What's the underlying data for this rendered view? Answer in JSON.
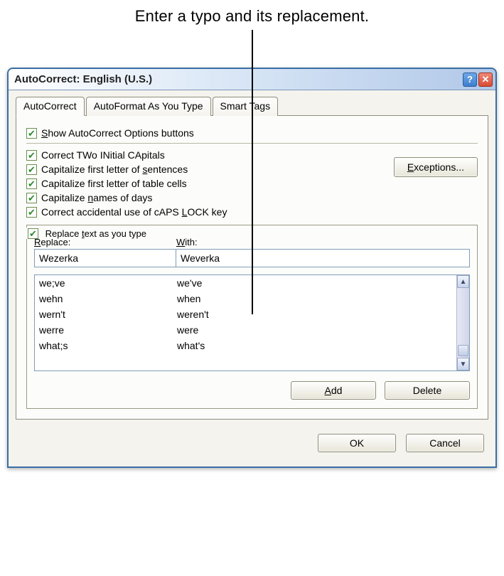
{
  "caption": "Enter a typo and its replacement.",
  "window": {
    "title": "AutoCorrect: English (U.S.)"
  },
  "tabs": [
    {
      "label": "AutoCorrect",
      "active": true
    },
    {
      "label": "AutoFormat As You Type",
      "active": false
    },
    {
      "label": "Smart Tags",
      "active": false
    }
  ],
  "checkboxes": {
    "show_buttons": "Show AutoCorrect Options buttons",
    "two_initial": "Correct TWo INitial CApitals",
    "first_sentence": "Capitalize first letter of sentences",
    "first_table": "Capitalize first letter of table cells",
    "names_days": "Capitalize names of days",
    "caps_lock": "Correct accidental use of cAPS LOCK key",
    "replace_as_type": "Replace text as you type"
  },
  "exceptions_btn": "Exceptions...",
  "labels": {
    "replace": "Replace:",
    "with": "With:"
  },
  "replace_value": "Wezerka",
  "with_value": "Weverka",
  "entries": [
    {
      "r": "we;ve",
      "w": "we've"
    },
    {
      "r": "wehn",
      "w": "when"
    },
    {
      "r": "wern't",
      "w": "weren't"
    },
    {
      "r": "werre",
      "w": "were"
    },
    {
      "r": "what;s",
      "w": "what's"
    }
  ],
  "buttons": {
    "add": "Add",
    "delete": "Delete",
    "ok": "OK",
    "cancel": "Cancel"
  }
}
